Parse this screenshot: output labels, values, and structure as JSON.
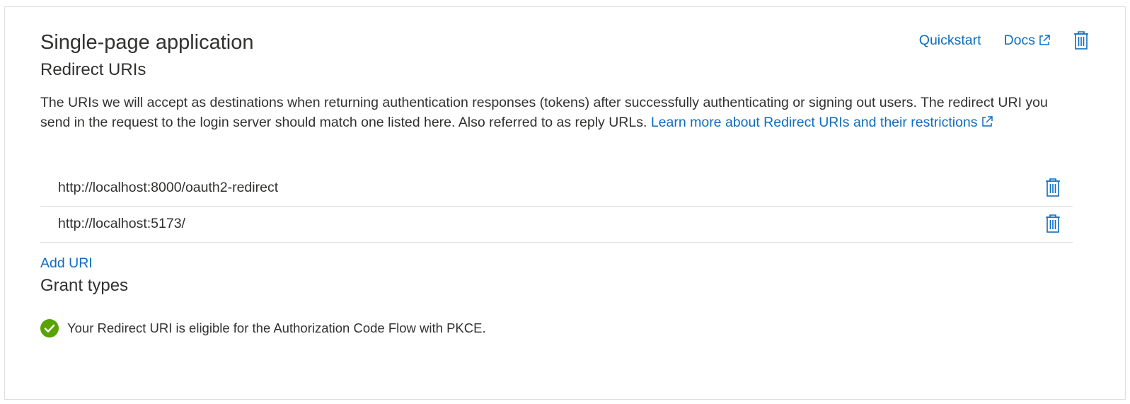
{
  "platform": {
    "title": "Single-page application",
    "subtitle": "Redirect URIs",
    "quickstart_label": "Quickstart",
    "docs_label": "Docs"
  },
  "description": {
    "text": "The URIs we will accept as destinations when returning authentication responses (tokens) after successfully authenticating or signing out users. The redirect URI you send in the request to the login server should match one listed here. Also referred to as reply URLs.",
    "link_text": "Learn more about Redirect URIs and their restrictions"
  },
  "redirect_uris": [
    "http://localhost:8000/oauth2-redirect",
    "http://localhost:5173/"
  ],
  "add_uri_label": "Add URI",
  "grant_types": {
    "title": "Grant types",
    "status_text": "Your Redirect URI is eligible for the Authorization Code Flow with PKCE.",
    "status_color": "#57a300"
  },
  "colors": {
    "link": "#0f6cbd",
    "text": "#323130",
    "border": "#e1dfdd"
  },
  "icons": {
    "delete": "trash-icon",
    "external": "external-link-icon",
    "success": "checkmark-circle-icon"
  }
}
